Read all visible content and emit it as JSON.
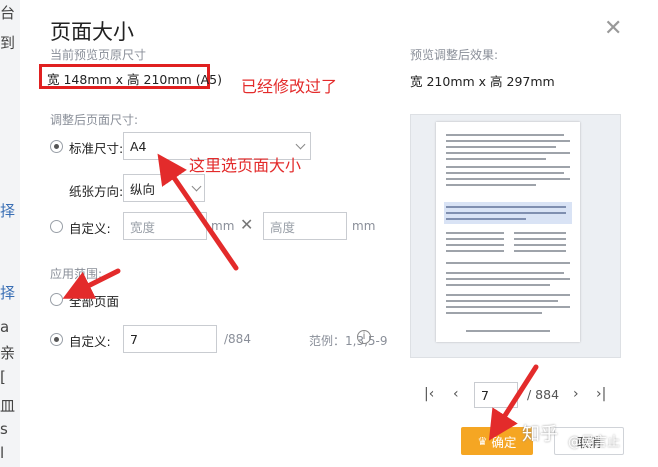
{
  "background": {
    "side_chars": [
      "台",
      "到",
      "择",
      "择",
      "a",
      "亲",
      "[",
      "皿",
      "s",
      "l"
    ]
  },
  "dialog": {
    "title": "页面大小",
    "close_glyph": "✕",
    "current": {
      "label": "当前预览页原尺寸",
      "value": "宽 148mm x 高 210mm (A5)"
    },
    "preview_result": {
      "label": "预览调整后效果:",
      "value": "宽 210mm x 高 297mm"
    },
    "adjusted_label": "调整后页面尺寸:",
    "standard": {
      "label": "标准尺寸:",
      "value": "A4"
    },
    "orientation": {
      "label": "纸张方向:",
      "value": "纵向"
    },
    "custom_size": {
      "label": "自定义:",
      "width_placeholder": "宽度",
      "height_placeholder": "高度",
      "unit": "mm",
      "times": "✕"
    },
    "scope": {
      "label": "应用范围:",
      "all_pages": "全部页面",
      "custom": {
        "label": "自定义:",
        "value": "7",
        "total": "/884",
        "example": "范例：1,3,5-9",
        "info_icon": "i"
      }
    },
    "pager": {
      "first": "|‹",
      "prev": "‹",
      "current": "7",
      "total": "/ 884",
      "next": "›",
      "last": "›|"
    },
    "ok_button": "确定",
    "cancel_button": "取消"
  },
  "annotations": {
    "modified": "已经修改过了",
    "select_here": "这里选页面大小"
  },
  "watermark": {
    "logo": "知乎",
    "user": "@吴言止"
  },
  "colors": {
    "annotation_red": "#e32b2b",
    "accent_orange": "#f5a623"
  }
}
